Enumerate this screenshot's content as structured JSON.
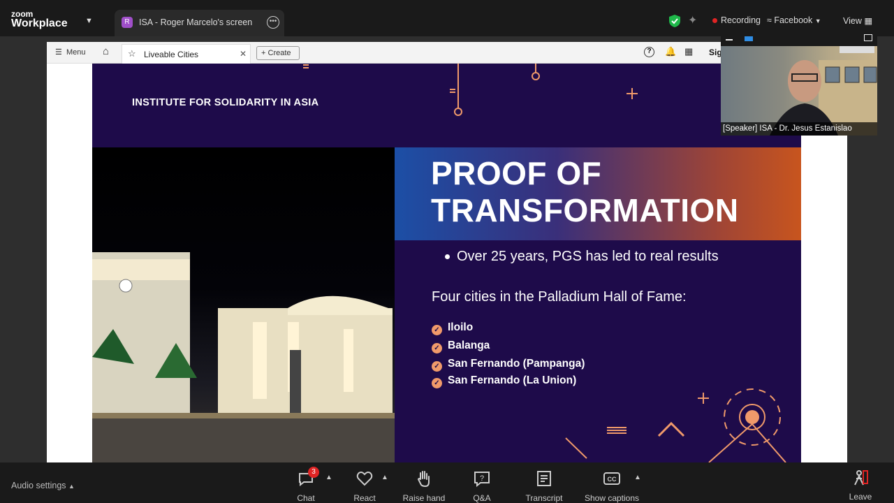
{
  "app": {
    "logo_top": "zoom",
    "logo_bottom": "Workplace"
  },
  "share_tab": {
    "badge": "R",
    "label": "ISA - Roger Marcelo's screen"
  },
  "top_right": {
    "recording": "Recording",
    "stream": "Facebook",
    "view": "View"
  },
  "browser": {
    "menu": "Menu",
    "tab_title": "Liveable Cities",
    "create": "Create",
    "sign_partial": "Sig"
  },
  "slide": {
    "org": "INSTITUTE FOR SOLIDARITY IN ASIA",
    "title_line1": "PROOF OF",
    "title_line2": "TRANSFORMATION",
    "bullet": "Over 25 years, PGS has led to real results",
    "subtitle": "Four cities in the Palladium Hall of Fame:",
    "cities": [
      "Iloilo",
      "Balanga",
      "San Fernando (Pampanga)",
      "San Fernando (La Union)"
    ]
  },
  "video": {
    "name": "[Speaker] ISA - Dr. Jesus Estanislao"
  },
  "bottom": {
    "audio_settings": "Audio settings",
    "chat": "Chat",
    "chat_badge": "3",
    "react": "React",
    "raise_hand": "Raise hand",
    "qa": "Q&A",
    "transcript": "Transcript",
    "captions": "Show captions",
    "leave": "Leave"
  },
  "colors": {
    "slide_bg": "#1e0b4a",
    "accent": "#f09a6a",
    "record": "#e02424",
    "shield": "#1fb84a"
  }
}
